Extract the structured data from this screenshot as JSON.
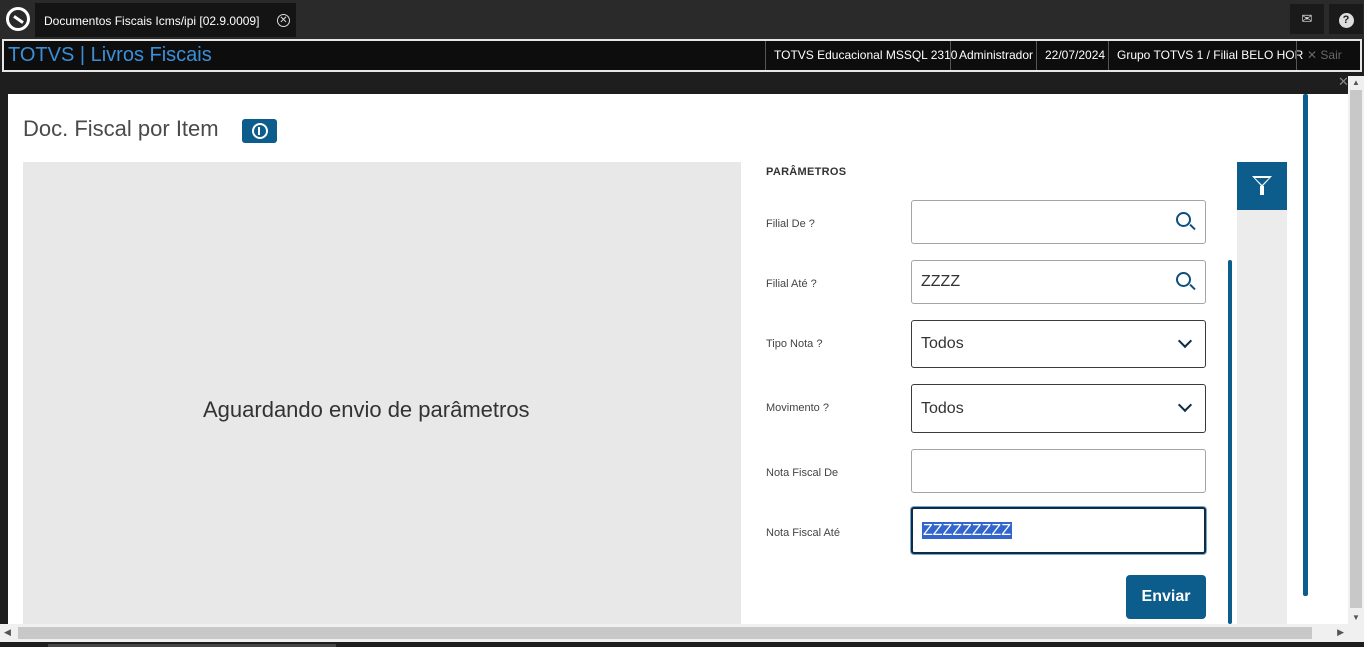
{
  "topbar": {
    "tab_label": "Documentos Fiscais Icms/ipi [02.9.0009]",
    "close_glyph": "✕",
    "mail_glyph": "✉",
    "help_glyph": "?"
  },
  "appbar": {
    "title": "TOTVS | Livros Fiscais",
    "environment": "TOTVS Educacional MSSQL 2310",
    "user": "Administrador",
    "date": "22/07/2024",
    "branch": "Grupo TOTVS 1 / Filial BELO HOR",
    "exit_label": "✕  Sair"
  },
  "page": {
    "title": "Doc. Fiscal por Item",
    "preview_message": "Aguardando envio de parâmetros"
  },
  "params": {
    "section_title": "PARÂMETROS",
    "fields": [
      {
        "label": "Filial De ?",
        "value": ""
      },
      {
        "label": "Filial Até ?",
        "value": "ZZZZ"
      },
      {
        "label": "Tipo Nota ?",
        "value": "Todos"
      },
      {
        "label": "Movimento ?",
        "value": "Todos"
      },
      {
        "label": "Nota Fiscal De",
        "value": ""
      },
      {
        "label": "Nota Fiscal Até",
        "value": "ZZZZZZZZZ"
      }
    ],
    "submit_label": "Enviar"
  },
  "icons": {
    "logo": "totvs-logo-icon",
    "info": "info-icon",
    "search": "search-icon",
    "dropdown": "chevron-down-icon",
    "filter": "filter-icon"
  },
  "colors": {
    "accent": "#0c5c8c",
    "app_title": "#3b8fd8",
    "selection": "#3366cc"
  }
}
